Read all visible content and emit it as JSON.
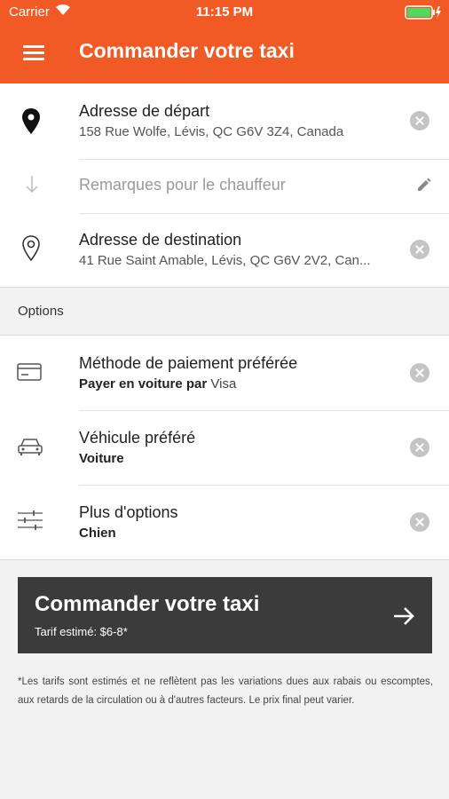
{
  "status_bar": {
    "carrier": "Carrier",
    "time": "11:15 PM"
  },
  "header": {
    "title": "Commander votre taxi"
  },
  "addresses": {
    "departure": {
      "label": "Adresse de départ",
      "value": "158 Rue Wolfe, Lévis, QC G6V 3Z4, Canada"
    },
    "remarks_placeholder": "Remarques pour le chauffeur",
    "destination": {
      "label": "Adresse de destination",
      "value": "41 Rue Saint Amable, Lévis, QC G6V 2V2, Can..."
    }
  },
  "options": {
    "title": "Options",
    "payment": {
      "label": "Méthode de paiement préférée",
      "value_prefix": "Payer en voiture par",
      "value_method": "Visa"
    },
    "vehicle": {
      "label": "Véhicule préféré",
      "value": "Voiture"
    },
    "more": {
      "label": "Plus d'options",
      "value": "Chien"
    }
  },
  "order_button": {
    "title": "Commander votre taxi",
    "fare": "Tarif estimé: $6-8*"
  },
  "disclaimer": "*Les tarifs sont estimés et ne reflètent pas les variations dues aux rabais ou escomptes, aux retards de la circulation ou à d'autres facteurs. Le prix final peut varier.",
  "colors": {
    "accent": "#f15a24",
    "button": "#3b3b3b",
    "background": "#f2f2f2"
  }
}
